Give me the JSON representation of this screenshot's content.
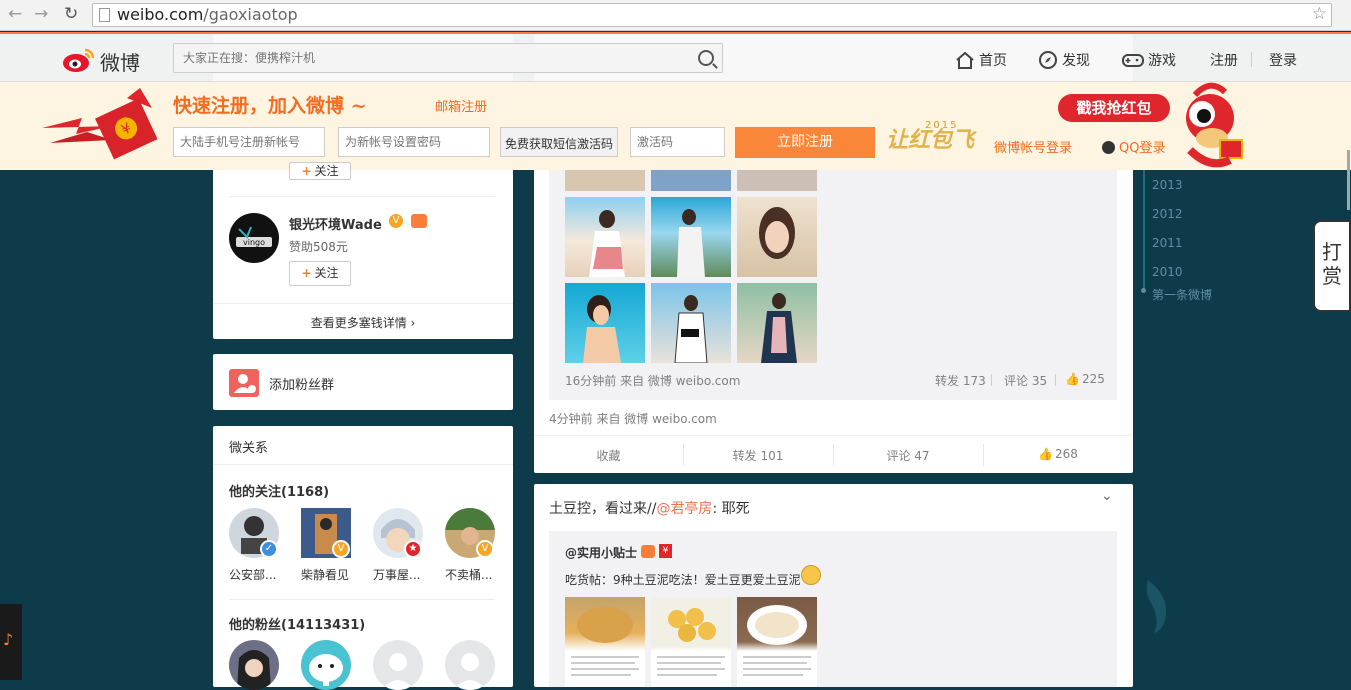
{
  "browser": {
    "url_domain": "weibo.com",
    "url_path": "/gaoxiaotop"
  },
  "topbar": {
    "logo_text": "微博",
    "search_placeholder": "大家正在搜：便携榨汁机",
    "nav": [
      {
        "label": "首页",
        "icon": "home-icon"
      },
      {
        "label": "发现",
        "icon": "compass-icon"
      },
      {
        "label": "游戏",
        "icon": "gamepad-icon"
      }
    ],
    "register": "注册",
    "login": "登录"
  },
  "regbar": {
    "slogan": "快速注册，加入微博 ~",
    "email_register": "邮箱注册",
    "phone_placeholder": "大陆手机号注册新帐号",
    "password_placeholder": "为新帐号设置密码",
    "sms_button": "免费获取短信激活码",
    "code_placeholder": "激活码",
    "register_button": "立即注册",
    "promo_year": "2015",
    "promo_text": "让红包飞",
    "weibo_login": "微博帐号登录",
    "qq_login": "QQ登录",
    "grab_button": "戳我抢红包"
  },
  "sponsor": {
    "follow_label": "关注",
    "name": "银光环境Wade",
    "amount": "赞助508元",
    "more": "查看更多塞钱详情 ›"
  },
  "fans_group": {
    "label": "添加粉丝群"
  },
  "relations": {
    "title": "微关系",
    "following_title": "他的关注(1168)",
    "following": [
      "公安部...",
      "柴静看见",
      "万事屋...",
      "不卖桶..."
    ],
    "fans_title": "他的粉丝(14113431)"
  },
  "post1": {
    "repost_meta": "16分钟前 来自 微博 weibo.com",
    "repost_forward": "转发 173",
    "repost_comment": "评论 35",
    "repost_like": "225",
    "meta": "4分钟前 来自 微博 weibo.com",
    "actions": {
      "collect": "收藏",
      "forward": "转发 101",
      "comment": "评论 47",
      "like": "268"
    }
  },
  "post2": {
    "text_prefix": "土豆控，看过来//",
    "mention": "@君亭房",
    "text_suffix": ": 耶死",
    "orig_author": "@实用小贴士",
    "orig_text": "吃货帖：9种土豆泥吃法！爱土豆更爱土豆泥"
  },
  "timeline": {
    "years": [
      "2013",
      "2012",
      "2011",
      "2010"
    ],
    "first": "第一条微博"
  },
  "dashang": {
    "label": "打赏"
  },
  "colors": {
    "accent": "#fa7d3c",
    "background": "#0e3b4a",
    "red": "#e0262d"
  }
}
